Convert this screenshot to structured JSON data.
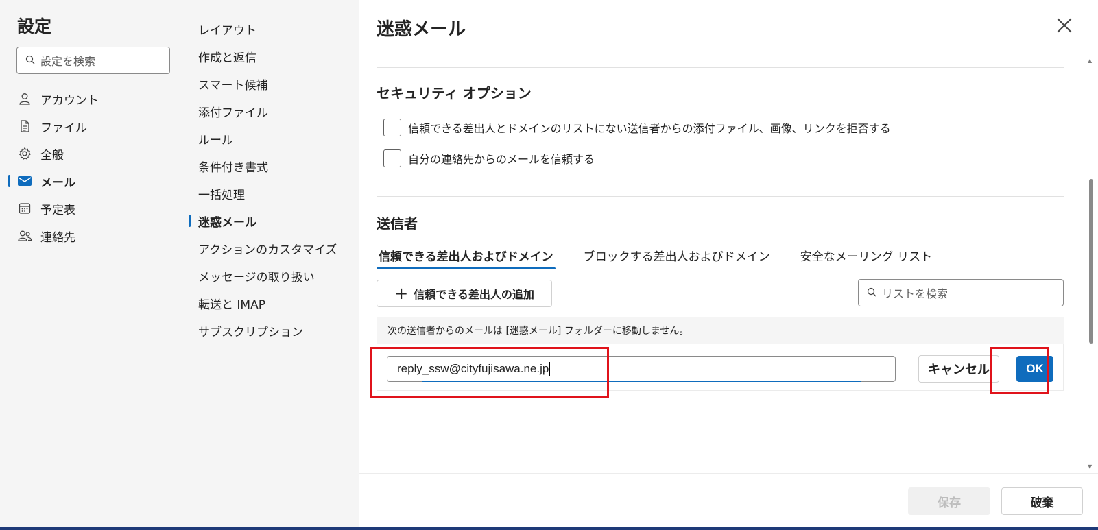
{
  "nav": {
    "title": "設定",
    "search_placeholder": "設定を検索",
    "items": [
      {
        "label": "アカウント",
        "icon": "person-icon"
      },
      {
        "label": "ファイル",
        "icon": "document-icon"
      },
      {
        "label": "全般",
        "icon": "gear-icon"
      },
      {
        "label": "メール",
        "icon": "mail-icon",
        "active": true
      },
      {
        "label": "予定表",
        "icon": "calendar-icon"
      },
      {
        "label": "連絡先",
        "icon": "people-icon"
      }
    ]
  },
  "mail_nav": {
    "items": [
      {
        "label": "レイアウト"
      },
      {
        "label": "作成と返信"
      },
      {
        "label": "スマート候補"
      },
      {
        "label": "添付ファイル"
      },
      {
        "label": "ルール"
      },
      {
        "label": "条件付き書式"
      },
      {
        "label": "一括処理"
      },
      {
        "label": "迷惑メール",
        "active": true
      },
      {
        "label": "アクションのカスタマイズ"
      },
      {
        "label": "メッセージの取り扱い"
      },
      {
        "label": "転送と IMAP"
      },
      {
        "label": "サブスクリプション"
      }
    ]
  },
  "pane": {
    "title": "迷惑メール",
    "security": {
      "title": "セキュリティ オプション",
      "options": [
        {
          "label": "信頼できる差出人とドメインのリストにない送信者からの添付ファイル、画像、リンクを拒否する",
          "checked": false
        },
        {
          "label": "自分の連絡先からのメールを信頼する",
          "checked": false
        }
      ]
    },
    "senders": {
      "title": "送信者",
      "tabs": [
        {
          "label": "信頼できる差出人およびドメイン",
          "active": true
        },
        {
          "label": "ブロックする差出人およびドメイン"
        },
        {
          "label": "安全なメーリング リスト"
        }
      ],
      "add_button": "信頼できる差出人の追加",
      "list_search_placeholder": "リストを検索",
      "info": "次の送信者からのメールは [迷惑メール] フォルダーに移動しません。",
      "entry_value": "reply_ssw@cityfujisawa.ne.jp",
      "cancel_label": "キャンセル",
      "ok_label": "OK"
    },
    "footer": {
      "save_label": "保存",
      "discard_label": "破棄"
    }
  },
  "colors": {
    "accent": "#0f6cbd",
    "highlight": "#e0131b",
    "nav_bg": "#f5f5f5"
  }
}
